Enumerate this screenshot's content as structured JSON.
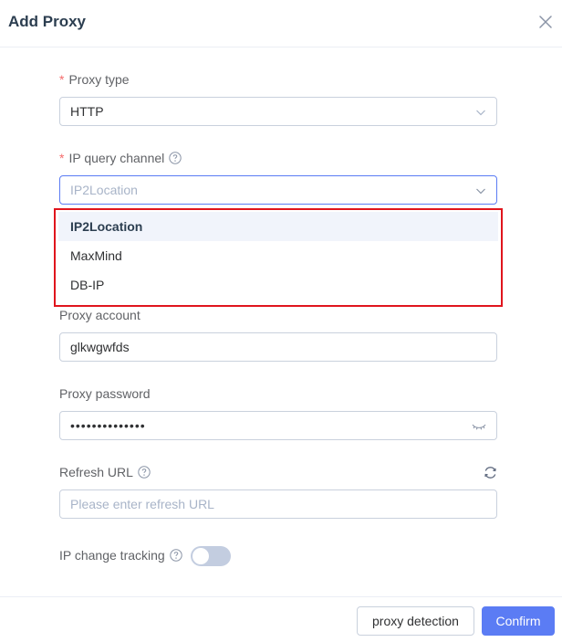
{
  "dialog": {
    "title": "Add Proxy"
  },
  "form": {
    "proxy_type": {
      "label": "Proxy type",
      "required_mark": "*",
      "value": "HTTP"
    },
    "ip_query_channel": {
      "label": "IP query channel",
      "required_mark": "*",
      "value": "IP2Location",
      "options": [
        "IP2Location",
        "MaxMind",
        "DB-IP"
      ],
      "selected_option": "IP2Location"
    },
    "proxy_account": {
      "label": "Proxy account",
      "value": "glkwgwfds"
    },
    "proxy_password": {
      "label": "Proxy password",
      "value": "••••••••••••••"
    },
    "refresh_url": {
      "label": "Refresh URL",
      "placeholder": "Please enter refresh URL",
      "value": ""
    },
    "ip_change_tracking": {
      "label": "IP change tracking",
      "enabled": false
    }
  },
  "footer": {
    "detect_label": "proxy detection",
    "confirm_label": "Confirm"
  },
  "colors": {
    "accent": "#5b7cf4",
    "required": "#f56c6c",
    "highlight_border": "#e0151d",
    "toggle_off": "#c3cde0"
  },
  "icons": {
    "close": "close-icon",
    "chevron": "chevron-down-icon",
    "help": "question-circle-icon",
    "eye": "eye-closed-icon",
    "refresh": "refresh-icon"
  }
}
